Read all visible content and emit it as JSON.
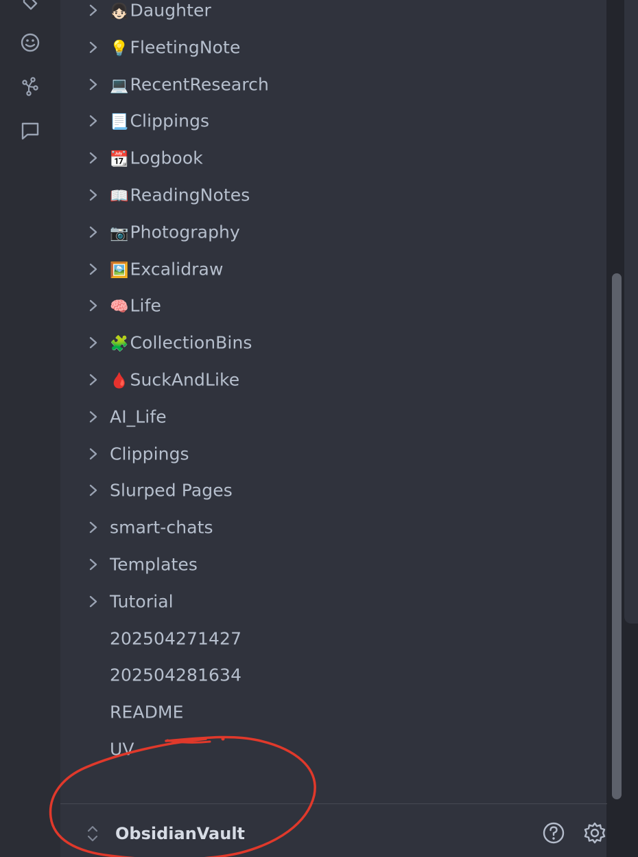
{
  "ribbon": {
    "icons": [
      "tags-icon",
      "smiley-icon",
      "graph-icon",
      "chat-icon"
    ]
  },
  "tree": {
    "items": [
      {
        "emoji": "👧🏻",
        "label": "Daughter",
        "folder": true
      },
      {
        "emoji": "💡",
        "label": "FleetingNote",
        "folder": true
      },
      {
        "emoji": "💻",
        "label": "RecentResearch",
        "folder": true
      },
      {
        "emoji": "📃",
        "label": "Clippings",
        "folder": true
      },
      {
        "emoji": "📆",
        "label": "Logbook",
        "folder": true
      },
      {
        "emoji": "📖",
        "label": "ReadingNotes",
        "folder": true
      },
      {
        "emoji": "📷",
        "label": "Photography",
        "folder": true
      },
      {
        "emoji": "🖼️",
        "label": "Excalidraw",
        "folder": true
      },
      {
        "emoji": "🧠",
        "label": "Life",
        "folder": true
      },
      {
        "emoji": "🧩",
        "label": "CollectionBins",
        "folder": true
      },
      {
        "emoji": "🩸",
        "label": "SuckAndLike",
        "folder": true
      },
      {
        "emoji": "",
        "label": "AI_Life",
        "folder": true
      },
      {
        "emoji": "",
        "label": "Clippings",
        "folder": true
      },
      {
        "emoji": "",
        "label": "Slurped Pages",
        "folder": true
      },
      {
        "emoji": "",
        "label": "smart-chats",
        "folder": true
      },
      {
        "emoji": "",
        "label": "Templates",
        "folder": true
      },
      {
        "emoji": "",
        "label": "Tutorial",
        "folder": true
      },
      {
        "emoji": "",
        "label": "202504271427",
        "folder": false
      },
      {
        "emoji": "",
        "label": "202504281634",
        "folder": false
      },
      {
        "emoji": "",
        "label": "README",
        "folder": false
      },
      {
        "emoji": "",
        "label": "UV",
        "folder": false
      }
    ]
  },
  "footer": {
    "vault_name": "ObsidianVault"
  },
  "colors": {
    "annotation": "#e0392b"
  }
}
